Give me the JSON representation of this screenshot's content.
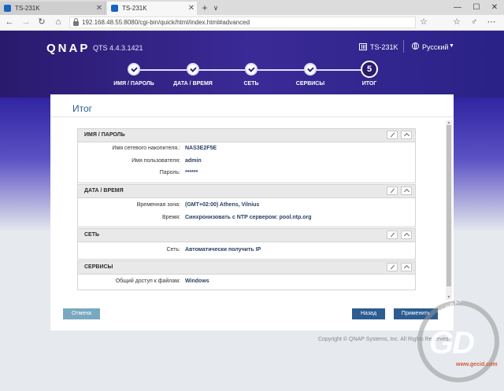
{
  "browser": {
    "tabs": [
      {
        "title": "TS-231K",
        "active": false
      },
      {
        "title": "TS-231K",
        "active": true
      }
    ],
    "new_tab": "+",
    "tab_list": "∨",
    "url": "192.168.48.55:8080/cgi-bin/quick/html/index.html#advanced"
  },
  "header": {
    "logo": "QNAP",
    "version": "QTS 4.4.3.1421",
    "device": "TS-231K",
    "language": "Русский"
  },
  "wizard": {
    "steps": [
      {
        "label": "ИМЯ / ПАРОЛЬ",
        "state": "done"
      },
      {
        "label": "ДАТА / ВРЕМЯ",
        "state": "done"
      },
      {
        "label": "СЕТЬ",
        "state": "done"
      },
      {
        "label": "СЕРВИСЫ",
        "state": "done"
      },
      {
        "label": "ИТОГ",
        "state": "current",
        "number": "5"
      }
    ]
  },
  "summary": {
    "title": "Итог",
    "sections": [
      {
        "title": "ИМЯ / ПАРОЛЬ",
        "rows": [
          {
            "label": "Имя сетевого накопителя.:",
            "value": "NAS3E2F5E"
          },
          {
            "label": "Имя пользователя:",
            "value": "admin"
          },
          {
            "label": "Пароль:",
            "value": "******"
          }
        ]
      },
      {
        "title": "ДАТА / ВРЕМЯ",
        "rows": [
          {
            "label": "Временная зона:",
            "value": "(GMT+02:00) Athens, Vilnius"
          },
          {
            "label": "Время:",
            "value": "Синхронизовать с NTP сервером: pool.ntp.org"
          }
        ]
      },
      {
        "title": "СЕТЬ",
        "rows": [
          {
            "label": "Сеть:",
            "value": "Автоматически получить IP"
          }
        ]
      },
      {
        "title": "СЕРВИСЫ",
        "rows": [
          {
            "label": "Общий доступ к файлам:",
            "value": "Windows"
          }
        ]
      }
    ]
  },
  "buttons": {
    "cancel": "Отмена",
    "back": "Назад",
    "apply": "Применить"
  },
  "footer": {
    "copyright": "Copyright © QNAP Systems, Inc. All Rights Reserved."
  },
  "watermark": {
    "top": "GLOBAL",
    "big": "GD",
    "site": "www.gecid.com"
  }
}
